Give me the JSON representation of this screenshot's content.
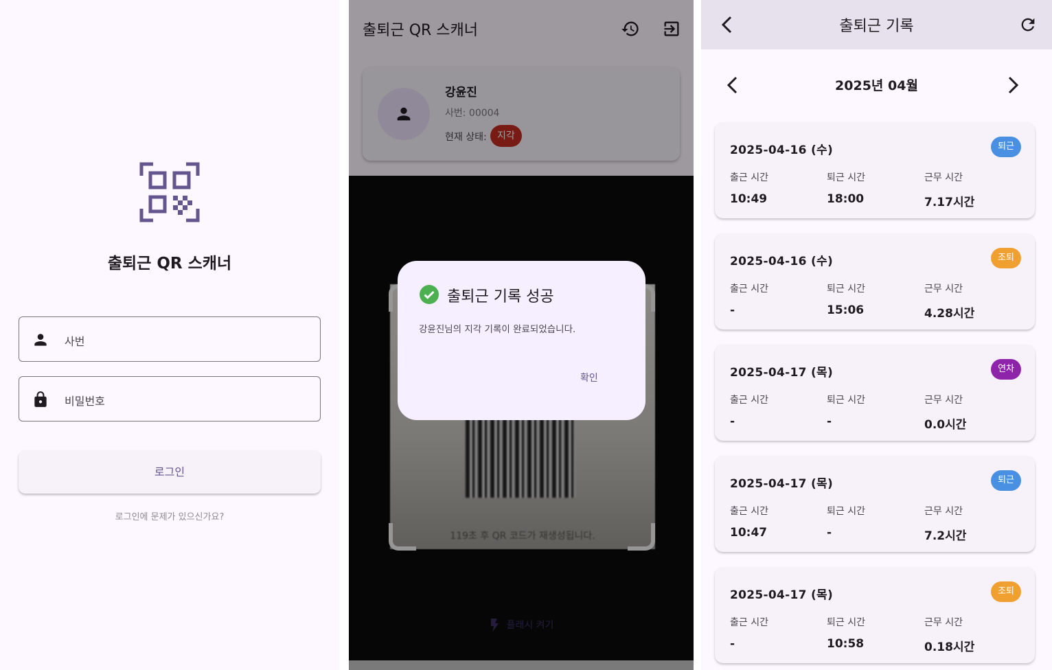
{
  "login": {
    "title": "출퇴근 QR 스캐너",
    "employee_id_placeholder": "사번",
    "password_placeholder": "비밀번호",
    "login_label": "로그인",
    "forgot_text": "로그인에 문제가 있으신가요?",
    "accent": "#65558f",
    "logo_icon": "qr-code-scanner-icon",
    "employee_icon": "person-icon",
    "password_icon": "lock-icon"
  },
  "scanner": {
    "title": "출퇴근 QR 스캐너",
    "history_icon": "history-icon",
    "logout_icon": "logout-icon",
    "employee": {
      "name": "강윤진",
      "id_text": "사번: 00004",
      "status_label": "현재 상태:",
      "status_value": "지각",
      "status_color": "#c42d23"
    },
    "regen_text": "119초 후 QR 코드가 재생성됩니다.",
    "flash_label": "플래시 켜기",
    "flash_icon": "flash-icon",
    "dialog": {
      "title": "출퇴근 기록 성공",
      "message": "강윤진님의 지각 기록이 완료되었습니다.",
      "ok_label": "확인",
      "icon": "check-circle-icon",
      "success_color": "#4caf50"
    }
  },
  "records": {
    "title": "출퇴근 기록",
    "back_icon": "chevron-left-icon",
    "refresh_icon": "refresh-icon",
    "month": "2025년 04월",
    "labels": {
      "in": "출근 시간",
      "out": "퇴근 시간",
      "work": "근무 시간"
    },
    "items": [
      {
        "date": "2025-04-16 (수)",
        "badge": "퇴근",
        "badge_color": "#4a90e2",
        "in": "10:49",
        "out": "18:00",
        "work": "7.17시간"
      },
      {
        "date": "2025-04-16 (수)",
        "badge": "조퇴",
        "badge_color": "#f0a030",
        "in": "-",
        "out": "15:06",
        "work": "4.28시간"
      },
      {
        "date": "2025-04-17 (목)",
        "badge": "연차",
        "badge_color": "#8e24aa",
        "in": "-",
        "out": "-",
        "work": "0.0시간"
      },
      {
        "date": "2025-04-17 (목)",
        "badge": "퇴근",
        "badge_color": "#4a90e2",
        "in": "10:47",
        "out": "-",
        "work": "7.2시간"
      },
      {
        "date": "2025-04-17 (목)",
        "badge": "조퇴",
        "badge_color": "#f0a030",
        "in": "-",
        "out": "10:58",
        "work": "0.18시간"
      }
    ]
  }
}
